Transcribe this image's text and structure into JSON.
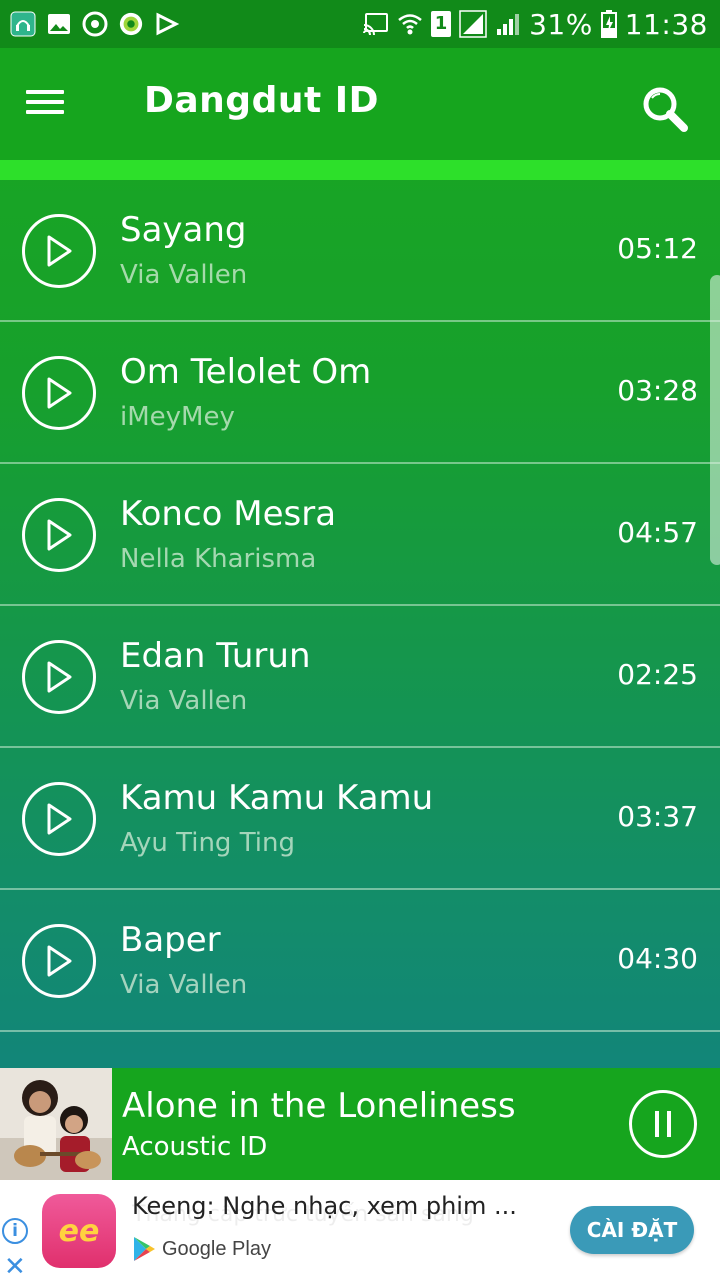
{
  "status_bar": {
    "battery_percent": "31%",
    "time": "11:38",
    "sim_label": "1"
  },
  "app_bar": {
    "title": "Dangdut ID"
  },
  "songs": [
    {
      "title": "Sayang",
      "artist": "Via Vallen",
      "duration": "05:12"
    },
    {
      "title": "Om Telolet Om",
      "artist": "iMeyMey",
      "duration": "03:28"
    },
    {
      "title": "Konco Mesra",
      "artist": "Nella Kharisma",
      "duration": "04:57"
    },
    {
      "title": "Edan Turun",
      "artist": "Via Vallen",
      "duration": "02:25"
    },
    {
      "title": "Kamu Kamu Kamu",
      "artist": "Ayu Ting Ting",
      "duration": "03:37"
    },
    {
      "title": "Baper",
      "artist": "Via Vallen",
      "duration": "04:30"
    }
  ],
  "now_playing": {
    "title": "Alone in the Loneliness",
    "artist": "Acoustic ID"
  },
  "ad": {
    "headline": "Keeng: Nghe nhạc, xem phim ...",
    "ghost_text": "Thăng cấp trức tuyến sẵn sàng",
    "store": "Google Play",
    "cta": "CÀI ĐẶT",
    "logo_text": "ee"
  },
  "colors": {
    "status_bar": "#118a19",
    "app_bar": "#16a51e",
    "accent_strip": "#2de02a",
    "cta": "#3a9ab8"
  }
}
